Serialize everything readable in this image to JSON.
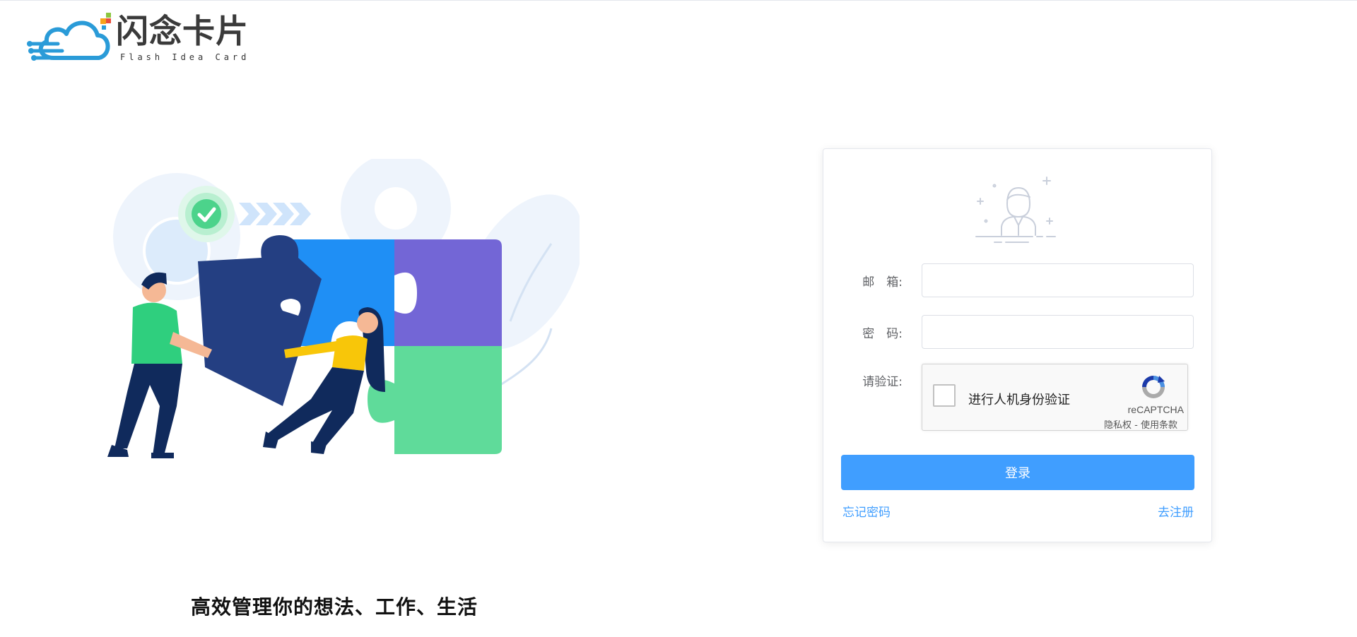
{
  "logo": {
    "title": "闪念卡片",
    "subtitle": "Flash Idea Card"
  },
  "slogan": "高效管理你的想法、工作、生活",
  "login": {
    "email_label": "邮　箱:",
    "email_value": "",
    "password_label": "密　码:",
    "password_value": "",
    "verify_label": "请验证:",
    "submit_label": "登录",
    "forgot_label": "忘记密码",
    "register_label": "去注册"
  },
  "recaptcha": {
    "label": "进行人机身份验证",
    "brand": "reCAPTCHA",
    "privacy": "隐私权",
    "separator": " - ",
    "terms": "使用条款"
  },
  "colors": {
    "primary": "#409eff",
    "text": "#606266",
    "puzzle_blue": "#1f8ff5",
    "puzzle_purple": "#7366d6",
    "puzzle_green": "#5fdb9a",
    "puzzle_navy": "#243f82"
  }
}
